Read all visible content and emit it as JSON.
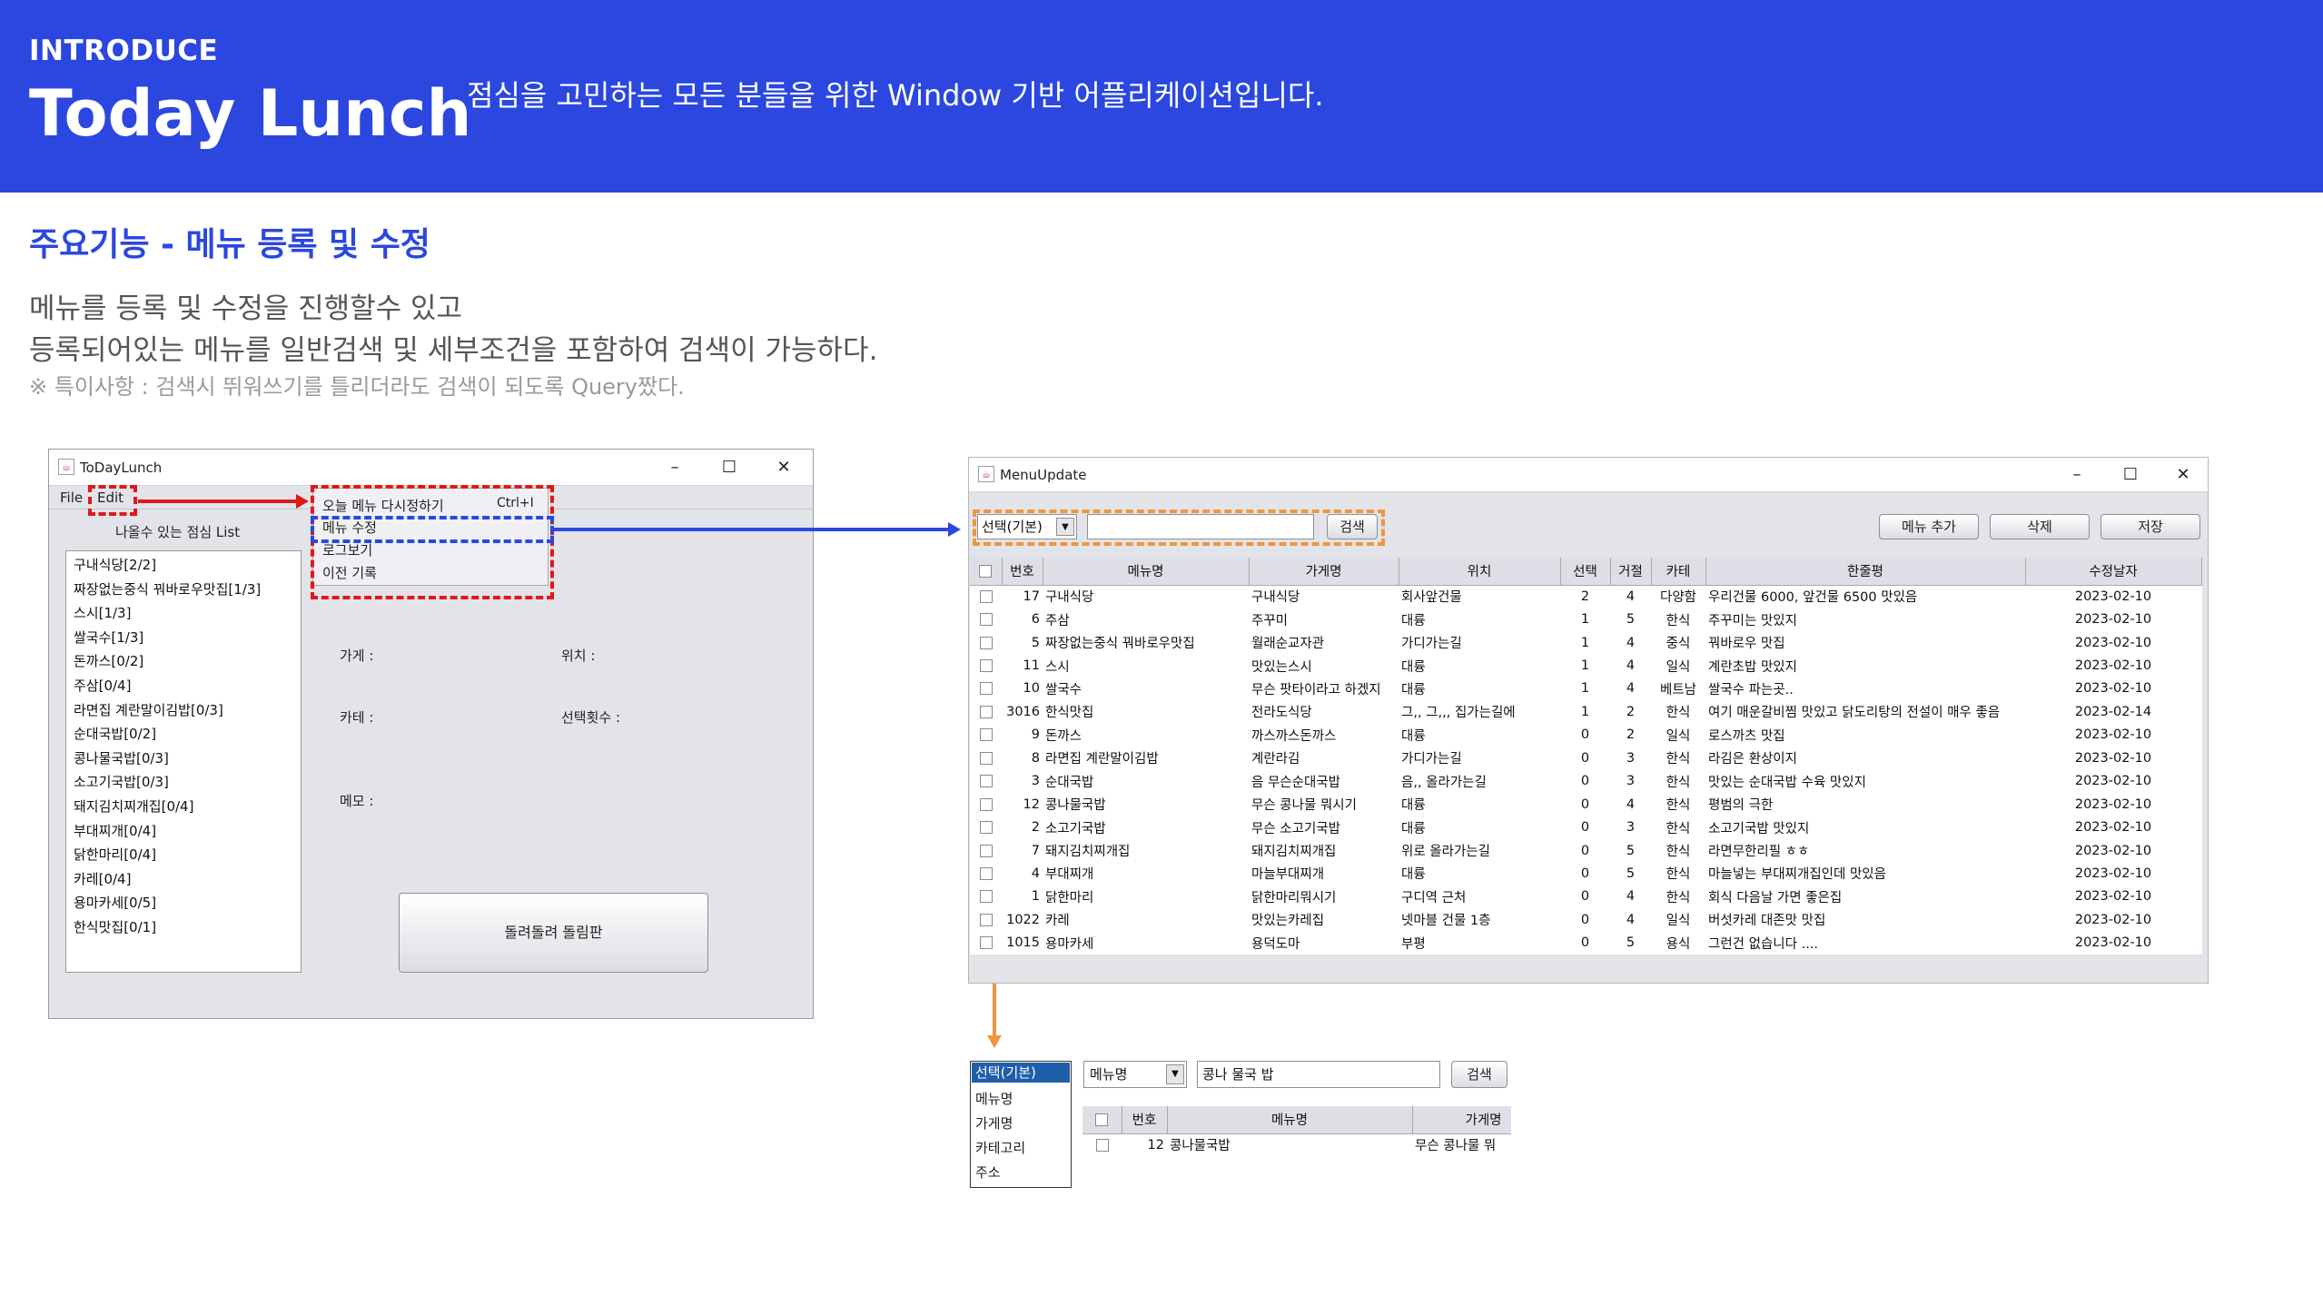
{
  "header": {
    "intro": "INTRODUCE",
    "title": "Today Lunch",
    "subtitle": "점심을 고민하는 모든 분들을 위한 Window 기반 어플리케이션입니다."
  },
  "section": {
    "title": "주요기능 - 메뉴 등록 및 수정",
    "desc_line1": "메뉴를 등록 및 수정을 진행할수 있고",
    "desc_line2": "등록되어있는 메뉴를 일반검색 및 세부조건을 포함하여 검색이 가능하다.",
    "note": "※ 특이사항 : 검색시 뛰워쓰기를 틀리더라도 검색이 되도록 Query짰다."
  },
  "colors": {
    "header_bg": "#2b47e0",
    "red_highlight": "#e01818",
    "blue_highlight": "#2b47e0",
    "orange_highlight": "#f0963c"
  },
  "main_window": {
    "title": "ToDayLunch",
    "menu_file": "File",
    "menu_edit": "Edit",
    "edit_menu": [
      {
        "label": "오늘 메뉴 다시정하기",
        "shortcut": "Ctrl+I"
      },
      {
        "label": "메뉴 수정",
        "shortcut": ""
      },
      {
        "label": "로그보기",
        "shortcut": ""
      },
      {
        "label": "이전 기록",
        "shortcut": ""
      }
    ],
    "list_title": "나올수 있는 점심 List",
    "list_items": [
      "구내식당[2/2]",
      "짜장없는중식 꿔바로우맛집[1/3]",
      "스시[1/3]",
      "쌀국수[1/3]",
      "돈까스[0/2]",
      "주삼[0/4]",
      "라면집 계란말이김밥[0/3]",
      "순대국밥[0/2]",
      "콩나물국밥[0/3]",
      "소고기국밥[0/3]",
      "돼지김치찌개집[0/4]",
      "부대찌개[0/4]",
      "닭한마리[0/4]",
      "카레[0/4]",
      "용마카세[0/5]",
      "한식맛집[0/1]"
    ],
    "label_store": "가게 :",
    "label_location": "위치 :",
    "label_category": "카테 :",
    "label_count": "선택횟수 :",
    "label_memo": "메모 :",
    "spin_button": "돌려돌려 돌림판"
  },
  "update_window": {
    "title": "MenuUpdate",
    "search_combo": "선택(기본)",
    "search_value": "",
    "search_button": "검색",
    "add_button": "메뉴 추가",
    "delete_button": "삭제",
    "save_button": "저장",
    "columns": [
      "",
      "번호",
      "메뉴명",
      "가게명",
      "위치",
      "선택",
      "거절",
      "카테",
      "한줄평",
      "수정날자"
    ],
    "rows": [
      [
        "17",
        "구내식당",
        "구내식당",
        "회사앞건물",
        "2",
        "4",
        "다양함",
        "우리건물 6000, 앞건물 6500 맛있음",
        "2023-02-10"
      ],
      [
        "6",
        "주삼",
        "주꾸미",
        "대륭",
        "1",
        "5",
        "한식",
        "주꾸미는 맛있지",
        "2023-02-10"
      ],
      [
        "5",
        "짜장없는중식 꿔바로우맛집",
        "월래순교자관",
        "가디가는길",
        "1",
        "4",
        "중식",
        "꿔바로우 맛집",
        "2023-02-10"
      ],
      [
        "11",
        "스시",
        "맛있는스시",
        "대륭",
        "1",
        "4",
        "일식",
        "계란초밥 맛있지",
        "2023-02-10"
      ],
      [
        "10",
        "쌀국수",
        "무슨 팟타이라고 하겠지",
        "대륭",
        "1",
        "4",
        "베트남",
        "쌀국수 파는곳..",
        "2023-02-10"
      ],
      [
        "3016",
        "한식맛집",
        "전라도식당",
        "그,, 그,,, 집가는길에",
        "1",
        "2",
        "한식",
        "여기 매운갈비찜 맛있고 닭도리탕의 전설이 매우 좋음",
        "2023-02-14"
      ],
      [
        "9",
        "돈까스",
        "까스까스돈까스",
        "대륭",
        "0",
        "2",
        "일식",
        "로스까츠 맛집",
        "2023-02-10"
      ],
      [
        "8",
        "라면집 계란말이김밥",
        "계란라김",
        "가디가는길",
        "0",
        "3",
        "한식",
        "라김은 환상이지",
        "2023-02-10"
      ],
      [
        "3",
        "순대국밥",
        "음 무슨순대국밥",
        "음,, 올라가는길",
        "0",
        "3",
        "한식",
        " 맛있는 순대국밥 수육 맛있지",
        "2023-02-10"
      ],
      [
        "12",
        "콩나물국밥",
        "무슨 콩나물 뭐시기",
        "대륭",
        "0",
        "4",
        "한식",
        "평범의 극한",
        "2023-02-10"
      ],
      [
        "2",
        "소고기국밥",
        "무슨 소고기국밥",
        "대륭",
        "0",
        "3",
        "한식",
        "소고기국밥 맛있지",
        "2023-02-10"
      ],
      [
        "7",
        "돼지김치찌개집",
        "돼지김치찌개집",
        "위로 올라가는길",
        "0",
        "5",
        "한식",
        "라면무한리필 ㅎㅎ",
        "2023-02-10"
      ],
      [
        "4",
        "부대찌개",
        "마늘부대찌개",
        "대륭",
        "0",
        "5",
        "한식",
        "마늘넣는 부대찌개집인데 맛있음",
        "2023-02-10"
      ],
      [
        "1",
        "닭한마리",
        "닭한마리뭐시기",
        "구디역 근처",
        "0",
        "4",
        "한식",
        "회식 다음날 가면 좋은집",
        "2023-02-10"
      ],
      [
        "1022",
        "카레",
        "맛있는카레집",
        "넷마블 건물 1층",
        "0",
        "4",
        "일식",
        "버섯카레 대존맛 맛집",
        "2023-02-10"
      ],
      [
        "1015",
        "용마카세",
        "용덕도마",
        "부평",
        "0",
        "5",
        "용식",
        "그런건 없습니다 ....",
        "2023-02-10"
      ]
    ]
  },
  "search_detail": {
    "dropdown_selected": "선택(기본)",
    "dropdown_options": [
      "메뉴명",
      "가게명",
      "카테고리",
      "주소"
    ],
    "field_combo": "메뉴명",
    "search_value": "콩나 물국 밥",
    "search_button": "검색",
    "columns": [
      "",
      "번호",
      "메뉴명",
      "가게명"
    ],
    "row": [
      "12",
      "콩나물국밥",
      "무슨 콩나물 뭐"
    ]
  }
}
